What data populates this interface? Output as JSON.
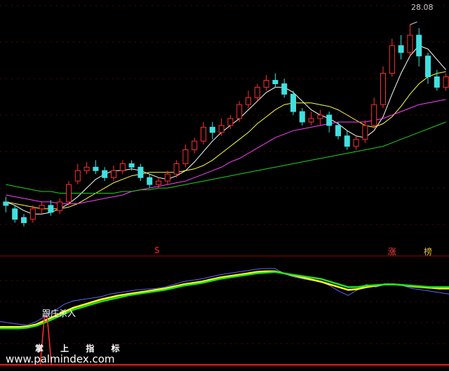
{
  "chart_data": {
    "type": "candlestick",
    "price_label": "28.08",
    "annotations": [
      {
        "text": "S",
        "color": "#ff2020",
        "index": 8
      },
      {
        "text": "涨",
        "color": "#ff4040",
        "index": 21
      },
      {
        "text": "榜",
        "color": "#e0c040",
        "index": 23
      }
    ],
    "candles": [
      [
        0.62,
        0.6,
        0.56,
        0.65
      ],
      [
        0.58,
        0.52,
        0.5,
        0.6
      ],
      [
        0.53,
        0.5,
        0.48,
        0.55
      ],
      [
        0.52,
        0.58,
        0.5,
        0.6
      ],
      [
        0.58,
        0.6,
        0.55,
        0.62
      ],
      [
        0.6,
        0.56,
        0.54,
        0.63
      ],
      [
        0.57,
        0.62,
        0.55,
        0.64
      ],
      [
        0.62,
        0.72,
        0.6,
        0.74
      ],
      [
        0.74,
        0.8,
        0.72,
        0.84
      ],
      [
        0.8,
        0.82,
        0.78,
        0.85
      ],
      [
        0.82,
        0.8,
        0.78,
        0.86
      ],
      [
        0.8,
        0.76,
        0.74,
        0.82
      ],
      [
        0.76,
        0.8,
        0.74,
        0.83
      ],
      [
        0.8,
        0.84,
        0.78,
        0.86
      ],
      [
        0.84,
        0.82,
        0.8,
        0.86
      ],
      [
        0.82,
        0.76,
        0.74,
        0.84
      ],
      [
        0.76,
        0.72,
        0.7,
        0.78
      ],
      [
        0.72,
        0.74,
        0.7,
        0.76
      ],
      [
        0.74,
        0.78,
        0.72,
        0.8
      ],
      [
        0.78,
        0.84,
        0.76,
        0.86
      ],
      [
        0.84,
        0.92,
        0.82,
        0.95
      ],
      [
        0.92,
        0.97,
        0.9,
        0.99
      ],
      [
        0.97,
        1.05,
        0.95,
        1.08
      ],
      [
        1.05,
        1.02,
        0.98,
        1.08
      ],
      [
        1.02,
        1.06,
        1.0,
        1.1
      ],
      [
        1.06,
        1.1,
        1.04,
        1.12
      ],
      [
        1.1,
        1.18,
        1.08,
        1.2
      ],
      [
        1.18,
        1.22,
        1.16,
        1.26
      ],
      [
        1.22,
        1.28,
        1.2,
        1.3
      ],
      [
        1.28,
        1.32,
        1.26,
        1.35
      ],
      [
        1.32,
        1.3,
        1.28,
        1.36
      ],
      [
        1.3,
        1.24,
        1.22,
        1.33
      ],
      [
        1.24,
        1.14,
        1.12,
        1.26
      ],
      [
        1.14,
        1.08,
        1.06,
        1.16
      ],
      [
        1.08,
        1.1,
        1.06,
        1.14
      ],
      [
        1.1,
        1.12,
        1.06,
        1.15
      ],
      [
        1.12,
        1.06,
        1.02,
        1.14
      ],
      [
        1.06,
        1.0,
        0.98,
        1.08
      ],
      [
        1.0,
        0.94,
        0.92,
        1.03
      ],
      [
        0.94,
        0.98,
        0.92,
        1.0
      ],
      [
        0.98,
        1.06,
        0.96,
        1.09
      ],
      [
        1.06,
        1.18,
        1.04,
        1.22
      ],
      [
        1.18,
        1.36,
        1.16,
        1.4
      ],
      [
        1.36,
        1.52,
        1.34,
        1.56
      ],
      [
        1.52,
        1.48,
        1.44,
        1.58
      ],
      [
        1.48,
        1.58,
        1.46,
        1.64
      ],
      [
        1.58,
        1.46,
        1.4,
        1.62
      ],
      [
        1.46,
        1.34,
        1.3,
        1.48
      ],
      [
        1.34,
        1.28,
        1.26,
        1.38
      ],
      [
        1.28,
        1.34,
        1.26,
        1.36
      ]
    ],
    "ma": [
      {
        "name": "MA5",
        "color": "#ffffff",
        "values": [
          0.62,
          0.6,
          0.57,
          0.55,
          0.55,
          0.56,
          0.58,
          0.61,
          0.65,
          0.7,
          0.75,
          0.78,
          0.8,
          0.8,
          0.81,
          0.8,
          0.78,
          0.76,
          0.75,
          0.77,
          0.8,
          0.85,
          0.91,
          0.97,
          1.02,
          1.06,
          1.1,
          1.15,
          1.2,
          1.25,
          1.28,
          1.28,
          1.25,
          1.2,
          1.15,
          1.12,
          1.1,
          1.07,
          1.03,
          1.0,
          0.99,
          1.03,
          1.11,
          1.24,
          1.36,
          1.46,
          1.52,
          1.5,
          1.44,
          1.38
        ]
      },
      {
        "name": "MA10",
        "color": "#ffff40",
        "values": [
          0.62,
          0.61,
          0.6,
          0.59,
          0.58,
          0.58,
          0.58,
          0.59,
          0.61,
          0.64,
          0.67,
          0.7,
          0.73,
          0.75,
          0.77,
          0.78,
          0.79,
          0.79,
          0.79,
          0.79,
          0.8,
          0.81,
          0.83,
          0.86,
          0.9,
          0.94,
          0.98,
          1.02,
          1.07,
          1.11,
          1.15,
          1.18,
          1.19,
          1.19,
          1.19,
          1.18,
          1.17,
          1.15,
          1.12,
          1.09,
          1.06,
          1.05,
          1.07,
          1.11,
          1.17,
          1.24,
          1.3,
          1.34,
          1.36,
          1.37
        ]
      },
      {
        "name": "MA20",
        "color": "#ff40ff",
        "values": [
          0.66,
          0.65,
          0.64,
          0.63,
          0.62,
          0.62,
          0.61,
          0.61,
          0.61,
          0.62,
          0.63,
          0.64,
          0.65,
          0.66,
          0.68,
          0.69,
          0.7,
          0.71,
          0.72,
          0.73,
          0.74,
          0.76,
          0.78,
          0.8,
          0.82,
          0.85,
          0.87,
          0.9,
          0.93,
          0.96,
          0.99,
          1.01,
          1.03,
          1.04,
          1.05,
          1.06,
          1.07,
          1.08,
          1.08,
          1.08,
          1.08,
          1.09,
          1.1,
          1.12,
          1.14,
          1.16,
          1.18,
          1.19,
          1.2,
          1.21
        ]
      },
      {
        "name": "MA60",
        "color": "#20d020",
        "values": [
          0.72,
          0.71,
          0.7,
          0.69,
          0.68,
          0.68,
          0.67,
          0.67,
          0.67,
          0.67,
          0.67,
          0.67,
          0.67,
          0.68,
          0.68,
          0.69,
          0.69,
          0.7,
          0.7,
          0.71,
          0.72,
          0.73,
          0.74,
          0.75,
          0.76,
          0.77,
          0.78,
          0.79,
          0.8,
          0.81,
          0.82,
          0.83,
          0.84,
          0.85,
          0.86,
          0.87,
          0.88,
          0.89,
          0.9,
          0.91,
          0.92,
          0.93,
          0.94,
          0.96,
          0.98,
          1.0,
          1.02,
          1.04,
          1.06,
          1.08
        ]
      }
    ],
    "indicator": {
      "label": "跟庄杀入",
      "lines": [
        {
          "name": "blue",
          "color": "#6060ff",
          "values": [
            0.2,
            0.18,
            0.16,
            0.15,
            0.2,
            0.28,
            0.36,
            0.45,
            0.5,
            0.52,
            0.54,
            0.56,
            0.6,
            0.62,
            0.64,
            0.66,
            0.67,
            0.68,
            0.7,
            0.74,
            0.78,
            0.8,
            0.82,
            0.85,
            0.88,
            0.9,
            0.92,
            0.94,
            0.96,
            0.97,
            0.97,
            0.9,
            0.85,
            0.82,
            0.8,
            0.78,
            0.72,
            0.64,
            0.58,
            0.66,
            0.74,
            0.7,
            0.74,
            0.74,
            0.72,
            0.68,
            0.66,
            0.64,
            0.62,
            0.6
          ]
        },
        {
          "name": "yellow",
          "color": "#ffff20",
          "values": [
            0.12,
            0.12,
            0.12,
            0.13,
            0.16,
            0.22,
            0.28,
            0.34,
            0.4,
            0.44,
            0.48,
            0.52,
            0.55,
            0.58,
            0.6,
            0.62,
            0.64,
            0.66,
            0.68,
            0.71,
            0.74,
            0.76,
            0.78,
            0.81,
            0.84,
            0.86,
            0.88,
            0.9,
            0.92,
            0.93,
            0.93,
            0.9,
            0.87,
            0.84,
            0.81,
            0.78,
            0.74,
            0.7,
            0.66,
            0.67,
            0.7,
            0.72,
            0.74,
            0.74,
            0.73,
            0.71,
            0.7,
            0.69,
            0.68,
            0.68
          ]
        },
        {
          "name": "green",
          "color": "#20e020",
          "values": [
            0.1,
            0.1,
            0.1,
            0.11,
            0.14,
            0.19,
            0.25,
            0.31,
            0.37,
            0.41,
            0.45,
            0.49,
            0.52,
            0.55,
            0.58,
            0.6,
            0.62,
            0.64,
            0.66,
            0.69,
            0.72,
            0.74,
            0.76,
            0.79,
            0.82,
            0.84,
            0.86,
            0.88,
            0.9,
            0.91,
            0.92,
            0.9,
            0.88,
            0.86,
            0.84,
            0.82,
            0.78,
            0.74,
            0.7,
            0.7,
            0.72,
            0.73,
            0.74,
            0.74,
            0.73,
            0.72,
            0.71,
            0.7,
            0.7,
            0.7
          ]
        }
      ],
      "pulse": {
        "index": 5,
        "color": "#ff3030"
      }
    }
  },
  "watermark_title": "掌 上 指 标",
  "watermark_url": "www.palmindex.com"
}
